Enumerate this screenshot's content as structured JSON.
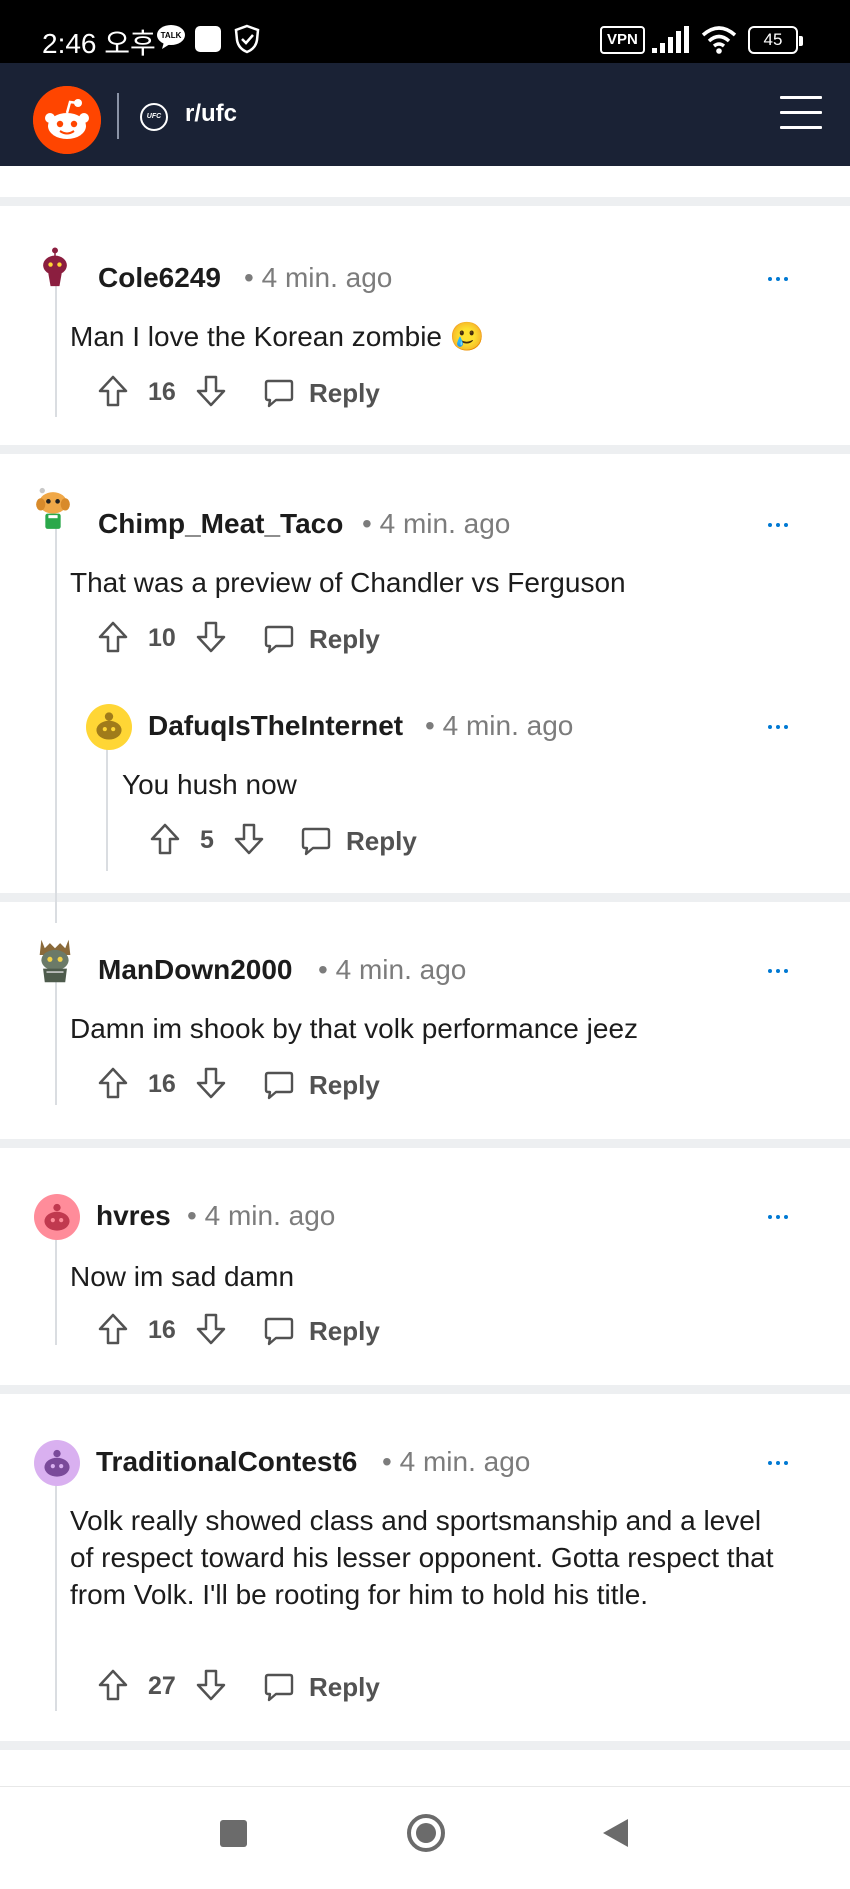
{
  "status_bar": {
    "time": "2:46 오후",
    "vpn": "VPN",
    "battery": "45"
  },
  "header": {
    "subreddit": "r/ufc",
    "subreddit_icon_text": "UFC"
  },
  "comments": [
    {
      "username": "Cole6249",
      "time": "4 min. ago",
      "body": "Man I love the Korean zombie 🥲",
      "votes": "16",
      "reply": "Reply"
    },
    {
      "username": "Chimp_Meat_Taco",
      "time": "4 min. ago",
      "body": "That was a preview of Chandler vs Ferguson",
      "votes": "10",
      "reply": "Reply"
    },
    {
      "username": "DafuqIsTheInternet",
      "time": "4 min. ago",
      "body": "You hush now",
      "votes": "5",
      "reply": "Reply"
    },
    {
      "username": "ManDown2000",
      "time": "4 min. ago",
      "body": "Damn im shook by that volk performance jeez",
      "votes": "16",
      "reply": "Reply"
    },
    {
      "username": "hvres",
      "time": "4 min. ago",
      "body": "Now im sad damn",
      "votes": "16",
      "reply": "Reply"
    },
    {
      "username": "TraditionalContest6",
      "time": "4 min. ago",
      "body": "Volk really showed class and sportsmanship and a level of respect toward his lesser opponent. Gotta respect that from Volk. I'll be rooting for him to hold his title.",
      "votes": "27",
      "reply": "Reply"
    }
  ],
  "colors": {
    "accent": "#0079d3",
    "header_bg": "#1a2235",
    "reddit_orange": "#ff4500"
  },
  "icons": [
    "talk-icon",
    "square-icon",
    "shield-check-icon",
    "signal-icon",
    "wifi-icon",
    "reddit-logo-icon",
    "ufc-icon",
    "menu-icon",
    "upvote-icon",
    "downvote-icon",
    "comment-bubble-icon",
    "more-dots-icon",
    "recents-icon",
    "home-icon",
    "back-icon"
  ]
}
